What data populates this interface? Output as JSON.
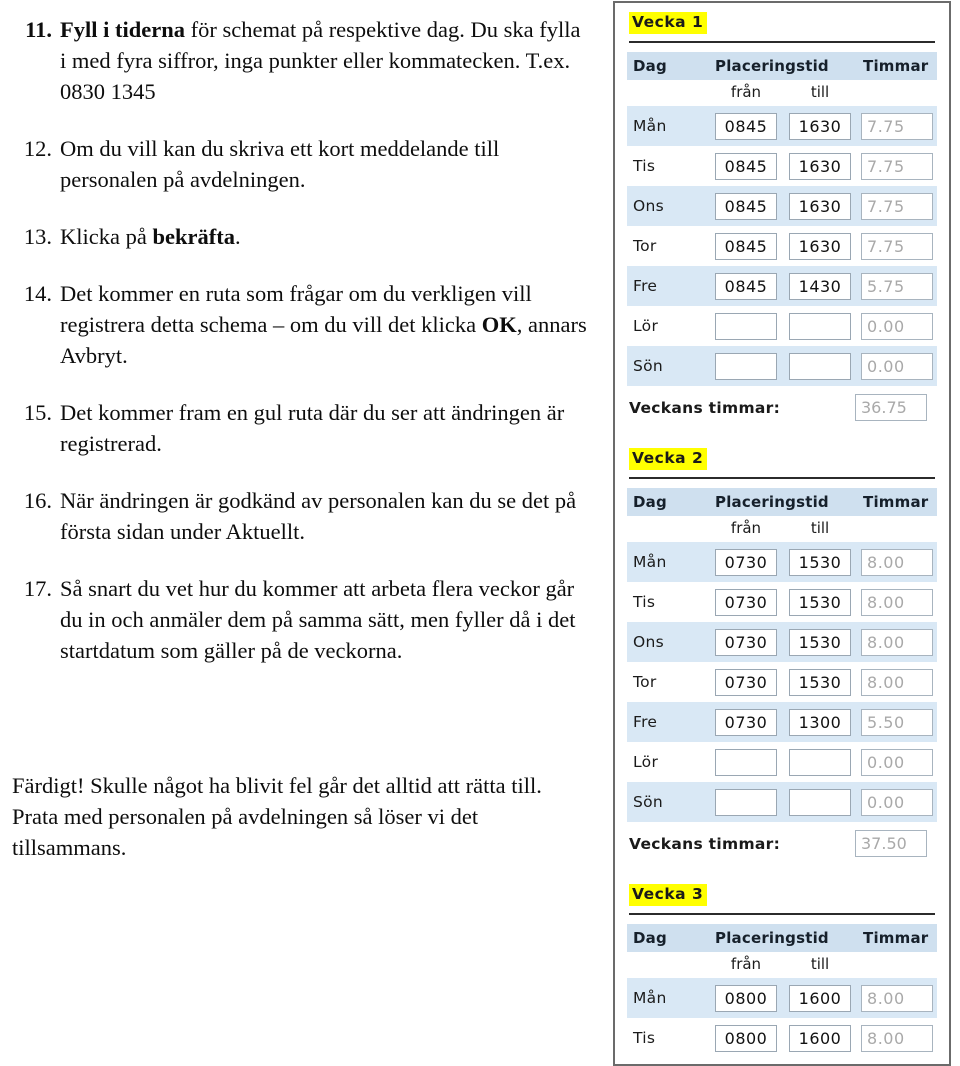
{
  "document": {
    "instructions": [
      {
        "number": "11.",
        "lead": "Fyll i tiderna",
        "rest": " för schemat på respektive dag. Du ska fylla i med fyra siffror, inga punkter eller kommatecken. T.ex. 0830 1345",
        "bold_number": true
      },
      {
        "number": "12.",
        "lead": "",
        "rest": "Om du vill kan du skriva ett kort meddelande till personalen på avdelningen.",
        "bold_number": false
      },
      {
        "number": "13.",
        "lead": "",
        "rest": "Klicka på ",
        "tail_bold": "bekräfta",
        "tail_rest": ".",
        "bold_number": false
      },
      {
        "number": "14.",
        "lead": "",
        "rest": "Det kommer en ruta som frågar om du verkligen vill registrera detta schema – om du vill det klicka ",
        "tail_bold": "OK",
        "tail_rest": ", annars Avbryt.",
        "bold_number": false
      },
      {
        "number": "15.",
        "lead": "",
        "rest": "Det kommer fram en gul ruta där du ser att ändringen är registrerad.",
        "bold_number": false
      },
      {
        "number": "16.",
        "lead": "",
        "rest": "När ändringen är godkänd av personalen kan du se det på första sidan under Aktuellt.",
        "bold_number": false
      },
      {
        "number": "17.",
        "lead": "",
        "rest": "Så snart du vet hur du kommer att arbeta flera veckor går du in och anmäler dem på samma sätt, men fyller då i det startdatum som gäller på de veckorna.",
        "bold_number": false
      }
    ],
    "closing": "Färdigt! Skulle något ha blivit fel går det alltid att rätta till. Prata med personalen på avdelningen så löser vi det tillsammans."
  },
  "app": {
    "colors": {
      "highlight": "#ffff00",
      "header_bg": "#cfe0ef",
      "row_stripe": "#d9e8f5",
      "readonly_text": "#a9a9a9",
      "panel_border": "#6b6b6b"
    },
    "table_headers": {
      "day": "Dag",
      "placeringstid": "Placeringstid",
      "timmar": "Timmar",
      "from": "från",
      "to": "till"
    },
    "total_label": "Veckans timmar:",
    "weeks": [
      {
        "title": "Vecka 1",
        "total": "36.75",
        "rows": [
          {
            "day": "Mån",
            "from": "0845",
            "to": "1630",
            "hours": "7.75"
          },
          {
            "day": "Tis",
            "from": "0845",
            "to": "1630",
            "hours": "7.75"
          },
          {
            "day": "Ons",
            "from": "0845",
            "to": "1630",
            "hours": "7.75"
          },
          {
            "day": "Tor",
            "from": "0845",
            "to": "1630",
            "hours": "7.75"
          },
          {
            "day": "Fre",
            "from": "0845",
            "to": "1430",
            "hours": "5.75"
          },
          {
            "day": "Lör",
            "from": "",
            "to": "",
            "hours": "0.00"
          },
          {
            "day": "Sön",
            "from": "",
            "to": "",
            "hours": "0.00"
          }
        ]
      },
      {
        "title": "Vecka 2",
        "total": "37.50",
        "rows": [
          {
            "day": "Mån",
            "from": "0730",
            "to": "1530",
            "hours": "8.00"
          },
          {
            "day": "Tis",
            "from": "0730",
            "to": "1530",
            "hours": "8.00"
          },
          {
            "day": "Ons",
            "from": "0730",
            "to": "1530",
            "hours": "8.00"
          },
          {
            "day": "Tor",
            "from": "0730",
            "to": "1530",
            "hours": "8.00"
          },
          {
            "day": "Fre",
            "from": "0730",
            "to": "1300",
            "hours": "5.50"
          },
          {
            "day": "Lör",
            "from": "",
            "to": "",
            "hours": "0.00"
          },
          {
            "day": "Sön",
            "from": "",
            "to": "",
            "hours": "0.00"
          }
        ]
      },
      {
        "title": "Vecka 3",
        "total": "",
        "rows": [
          {
            "day": "Mån",
            "from": "0800",
            "to": "1600",
            "hours": "8.00"
          },
          {
            "day": "Tis",
            "from": "0800",
            "to": "1600",
            "hours": "8.00"
          }
        ]
      }
    ]
  }
}
